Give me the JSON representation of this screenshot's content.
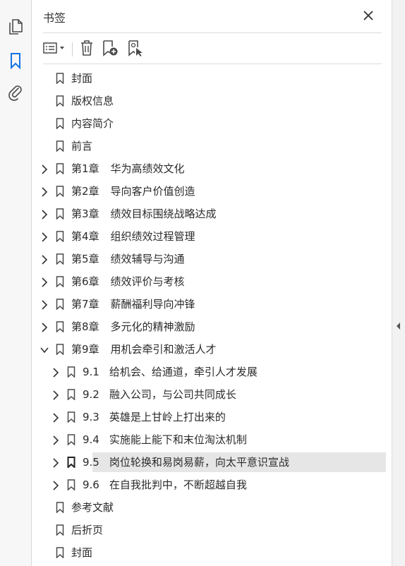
{
  "panel": {
    "title": "书签",
    "close_icon": "close-icon"
  },
  "rail": {
    "items": [
      {
        "icon": "page-thumbnails-icon",
        "active": false
      },
      {
        "icon": "bookmark-icon",
        "active": true
      },
      {
        "icon": "attachment-icon",
        "active": false
      }
    ]
  },
  "toolbar": {
    "buttons": [
      {
        "icon": "options-menu-icon"
      },
      {
        "icon": "delete-bookmark-icon"
      },
      {
        "icon": "new-bookmark-icon"
      },
      {
        "icon": "new-bookmark-from-structure-icon"
      }
    ]
  },
  "bookmarks": [
    {
      "level": 0,
      "expander": "none",
      "num": "",
      "title": "封面"
    },
    {
      "level": 0,
      "expander": "none",
      "num": "",
      "title": "版权信息"
    },
    {
      "level": 0,
      "expander": "none",
      "num": "",
      "title": "内容简介"
    },
    {
      "level": 0,
      "expander": "none",
      "num": "",
      "title": "前言"
    },
    {
      "level": 0,
      "expander": "collapsed",
      "num": "第1章",
      "title": "华为高绩效文化"
    },
    {
      "level": 0,
      "expander": "collapsed",
      "num": "第2章",
      "title": "导向客户价值创造"
    },
    {
      "level": 0,
      "expander": "collapsed",
      "num": "第3章",
      "title": "绩效目标围绕战略达成"
    },
    {
      "level": 0,
      "expander": "collapsed",
      "num": "第4章",
      "title": "组织绩效过程管理"
    },
    {
      "level": 0,
      "expander": "collapsed",
      "num": "第5章",
      "title": "绩效辅导与沟通"
    },
    {
      "level": 0,
      "expander": "collapsed",
      "num": "第6章",
      "title": "绩效评价与考核"
    },
    {
      "level": 0,
      "expander": "collapsed",
      "num": "第7章",
      "title": "薪酬福利导向冲锋"
    },
    {
      "level": 0,
      "expander": "collapsed",
      "num": "第8章",
      "title": "多元化的精神激励"
    },
    {
      "level": 0,
      "expander": "expanded",
      "num": "第9章",
      "title": "用机会牵引和激活人才"
    },
    {
      "level": 1,
      "expander": "collapsed",
      "num": "9.1",
      "title": "给机会、给通道，牵引人才发展"
    },
    {
      "level": 1,
      "expander": "collapsed",
      "num": "9.2",
      "title": "融入公司，与公司共同成长"
    },
    {
      "level": 1,
      "expander": "collapsed",
      "num": "9.3",
      "title": "英雄是上甘岭上打出来的"
    },
    {
      "level": 1,
      "expander": "collapsed",
      "num": "9.4",
      "title": "实施能上能下和末位淘汰机制"
    },
    {
      "level": 1,
      "expander": "collapsed",
      "num": "9.5",
      "title": "岗位轮换和易岗易薪，向太平意识宣战",
      "selected": true
    },
    {
      "level": 1,
      "expander": "collapsed",
      "num": "9.6",
      "title": "在自我批判中，不断超越自我"
    },
    {
      "level": 0,
      "expander": "none",
      "num": "",
      "title": "参考文献"
    },
    {
      "level": 0,
      "expander": "none",
      "num": "",
      "title": "后折页"
    },
    {
      "level": 0,
      "expander": "none",
      "num": "",
      "title": "封面"
    }
  ],
  "colors": {
    "selected_bg": "#e6e6e6",
    "active_icon": "#1473e6",
    "icon_gray": "#4b4b4b"
  }
}
